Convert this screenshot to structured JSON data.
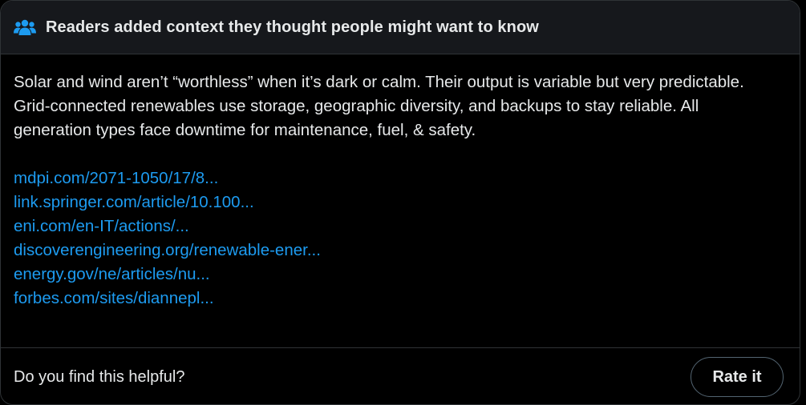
{
  "header": {
    "icon": "people-group-icon",
    "title": "Readers added context they thought people might want to know"
  },
  "note": {
    "text": "Solar and wind aren’t “worthless” when it’s dark or calm. Their output is variable but very predictable. Grid-connected renewables use storage, geographic diversity, and backups to stay reliable. All generation types face downtime for maintenance,  fuel, & safety.",
    "links": [
      "mdpi.com/2071-1050/17/8...",
      "link.springer.com/article/10.100...",
      "eni.com/en-IT/actions/...",
      "discoverengineering.org/renewable-ener...",
      "energy.gov/ne/articles/nu...",
      "forbes.com/sites/diannepl..."
    ]
  },
  "footer": {
    "question": "Do you find this helpful?",
    "rate_label": "Rate it"
  },
  "colors": {
    "background": "#000000",
    "header_bg": "#16181c",
    "text": "#e7e9ea",
    "link": "#1d9bf0",
    "icon": "#1d9bf0",
    "border": "#2f3336"
  }
}
